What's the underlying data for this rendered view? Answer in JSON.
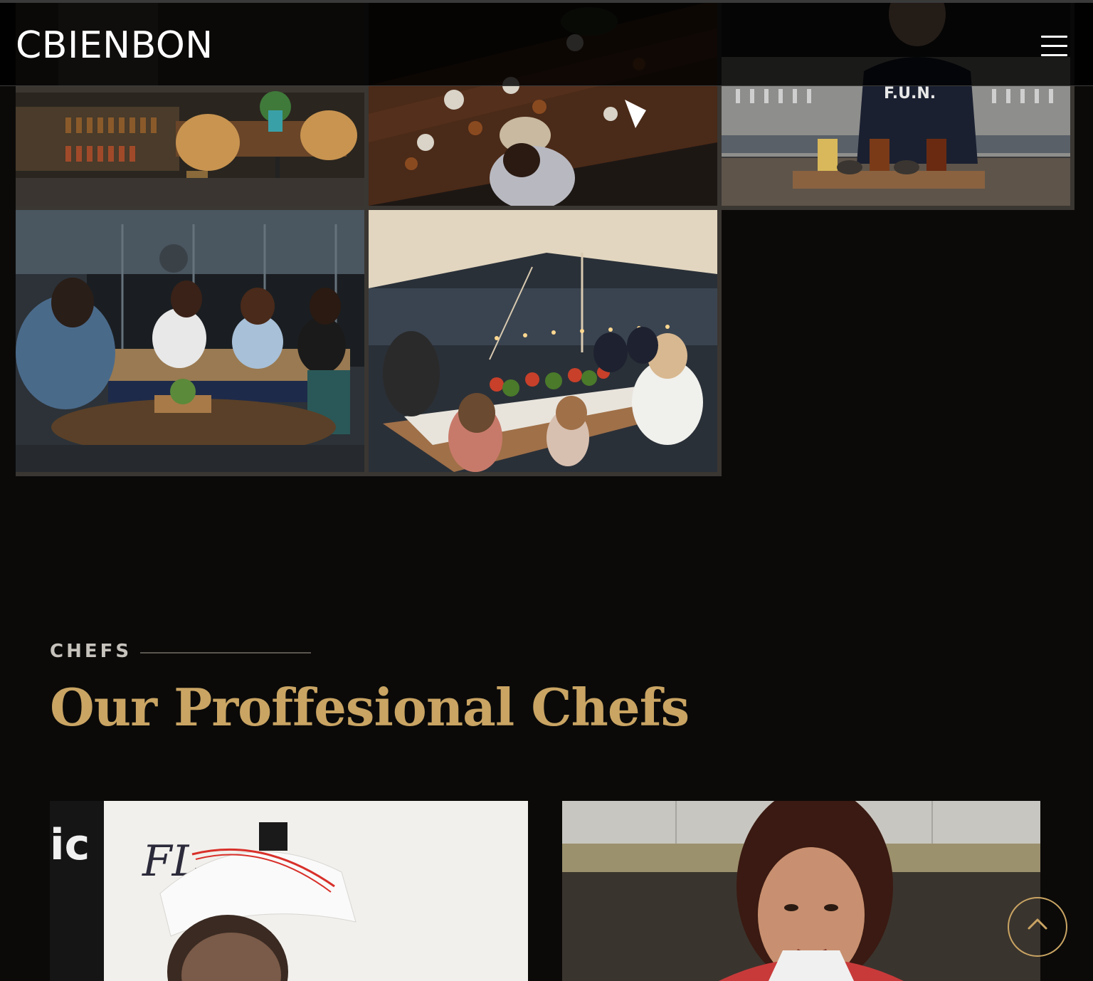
{
  "header": {
    "logo_text": "CBIENBON",
    "menu_icon": "hamburger-icon"
  },
  "gallery": {
    "images": [
      {
        "description_name": "cafe-interior-photo"
      },
      {
        "description_name": "dinner-table-overhead-photo"
      },
      {
        "description_name": "bartender-beer-flight-photo"
      },
      {
        "description_name": "friends-patio-photo"
      },
      {
        "description_name": "outdoor-dinner-party-photo"
      }
    ]
  },
  "chefs_section": {
    "eyebrow": "CHEFS",
    "title": "Our Proffesional Chefs",
    "cards": [
      {
        "name": "chef-card-male"
      },
      {
        "name": "chef-card-female"
      }
    ]
  },
  "scroll_top": {
    "icon": "arrow-up-icon"
  },
  "colors": {
    "background": "#0b0a09",
    "accent_gold": "#c9a463",
    "eyebrow_gray": "#c6c2bc"
  }
}
